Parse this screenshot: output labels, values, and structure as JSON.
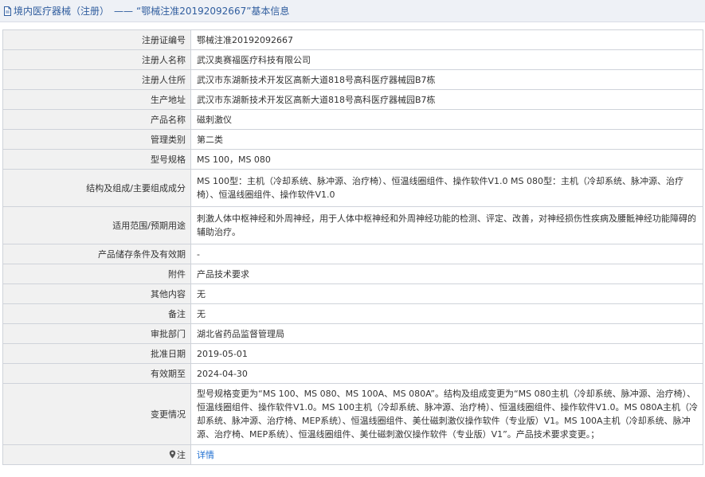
{
  "header": {
    "category": "境内医疗器械（注册）",
    "separator": "——",
    "title": "“鄂械注准20192092667”基本信息"
  },
  "fields": [
    {
      "label": "注册证编号",
      "value": "鄂械注准20192092667"
    },
    {
      "label": "注册人名称",
      "value": "武汉奥赛福医疗科技有限公司"
    },
    {
      "label": "注册人住所",
      "value": "武汉市东湖新技术开发区高新大道818号高科医疗器械园B7栋"
    },
    {
      "label": "生产地址",
      "value": "武汉市东湖新技术开发区高新大道818号高科医疗器械园B7栋"
    },
    {
      "label": "产品名称",
      "value": "磁刺激仪"
    },
    {
      "label": "管理类别",
      "value": "第二类"
    },
    {
      "label": "型号规格",
      "value": "MS 100，MS 080"
    },
    {
      "label": "结构及组成/主要组成成分",
      "value": "MS 100型：主机（冷却系统、脉冲源、治疗椅）、恒温线圈组件、操作软件V1.0 MS 080型：主机（冷却系统、脉冲源、治疗椅）、恒温线圈组件、操作软件V1.0"
    },
    {
      "label": "适用范围/预期用途",
      "value": "刺激人体中枢神经和外周神经，用于人体中枢神经和外周神经功能的检测、评定、改善，对神经损伤性疾病及腰骶神经功能障碍的辅助治疗。"
    },
    {
      "label": "产品储存条件及有效期",
      "value": "-"
    },
    {
      "label": "附件",
      "value": "产品技术要求"
    },
    {
      "label": "其他内容",
      "value": "无"
    },
    {
      "label": "备注",
      "value": "无"
    },
    {
      "label": "审批部门",
      "value": "湖北省药品监督管理局"
    },
    {
      "label": "批准日期",
      "value": "2019-05-01"
    },
    {
      "label": "有效期至",
      "value": "2024-04-30"
    },
    {
      "label": "变更情况",
      "value": "型号规格变更为“MS 100、MS 080、MS 100A、MS 080A”。结构及组成变更为“MS 080主机（冷却系统、脉冲源、治疗椅）、恒温线圈组件、操作软件V1.0。MS 100主机（冷却系统、脉冲源、治疗椅）、恒温线圈组件、操作软件V1.0。MS 080A主机（冷却系统、脉冲源、治疗椅、MEP系统）、恒温线圈组件、美仕磁刺激仪操作软件（专业版）V1。MS 100A主机（冷却系统、脉冲源、治疗椅、MEP系统）、恒温线圈组件、美仕磁刺激仪操作软件（专业版）V1”。产品技术要求变更。；"
    }
  ],
  "note": {
    "label": "注",
    "link_text": "详情"
  },
  "colors": {
    "header_bg": "#eef1f6",
    "header_text": "#2f5d9e",
    "label_bg": "#f1f1f1",
    "border": "#cfd3da",
    "link": "#1f6fd1"
  }
}
